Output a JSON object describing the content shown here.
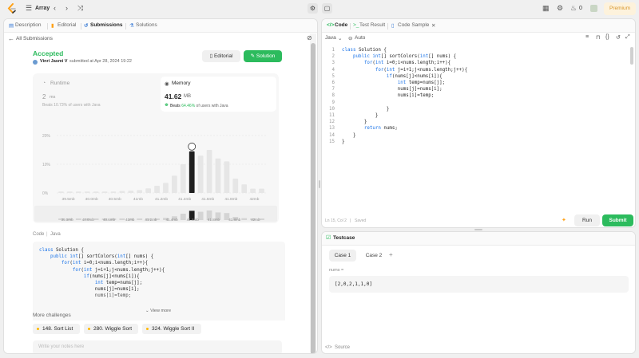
{
  "topbar": {
    "problem_list_label": "Array",
    "premium_label": "Premium",
    "streak_count": "0"
  },
  "left_tabs": [
    {
      "label": "Description"
    },
    {
      "label": "Editorial"
    },
    {
      "label": "Submissions"
    },
    {
      "label": "Solutions"
    }
  ],
  "submission": {
    "back_label": "All Submissions",
    "status": "Accepted",
    "author": "Vinri Jasmi V",
    "submitted_text": "submitted at Apr 28, 2024 19:22",
    "editorial_button": "Editorial",
    "solution_button": "Solution",
    "runtime": {
      "label": "Runtime",
      "value": "2",
      "unit": "ms",
      "beats": "Beats 10.73% of users with Java"
    },
    "memory": {
      "label": "Memory",
      "value": "41.62",
      "unit": "MB",
      "beats_prefix": "Beats",
      "beats_pct": "64.46%",
      "beats_suffix": "of users with Java"
    }
  },
  "chart_data": {
    "type": "bar",
    "ylabels": [
      "20%",
      "10%",
      "0%"
    ],
    "ylim": [
      0,
      20
    ],
    "categories": [
      "39.5mb",
      "40.0mb",
      "40.6mb",
      "41mb",
      "41.2mb",
      "41.4mb",
      "41.6mb",
      "41.8mb",
      "41.8mb",
      "42mb"
    ],
    "tick_labels": [
      "39.5mb",
      "40.0mb",
      "40.5mb",
      "41mb",
      "41.2mb",
      "41.4mb",
      "41.6mb",
      "41.8mb",
      "42mb"
    ],
    "values": [
      0.5,
      0.5,
      0.5,
      0.5,
      0.5,
      0.5,
      0.5,
      0.7,
      0.8,
      1.0,
      1.6,
      2.5,
      3.5,
      6,
      10,
      14.5,
      13,
      15,
      12,
      11,
      5,
      3,
      1.5,
      1.5
    ],
    "highlight_index": 15,
    "mini_labels": [
      "39.5mb",
      "40.0mb",
      "40.6mb",
      "41mb",
      "41.2mb",
      "41.4mb",
      "41.6mb",
      "41.8mb",
      "41.8mb",
      "42mb"
    ]
  },
  "code_section": {
    "label": "Code",
    "language": "Java",
    "lines": [
      "class Solution {",
      "    public int[] sortColors(int[] nums) {",
      "        for(int i=0;i<nums.length;i++){",
      "            for(int j=i+1;j<nums.length;j++){",
      "                if(nums[j]<nums[i]){",
      "                    int temp=nums[j];",
      "                    nums[j]=nums[i];",
      "                    nums[i]=temp;"
    ],
    "view_more": "View more"
  },
  "challenges": {
    "title": "More challenges",
    "items": [
      {
        "label": "148. Sort List"
      },
      {
        "label": "280. Wiggle Sort"
      },
      {
        "label": "324. Wiggle Sort II"
      }
    ]
  },
  "notes_placeholder": "Write your notes here",
  "editor": {
    "tabs": [
      {
        "label": "Code"
      },
      {
        "label": "Test Result"
      },
      {
        "label": "Code Sample"
      }
    ],
    "language": "Java",
    "mode": "Auto",
    "lines": [
      "class Solution {",
      "    public int[] sortColors(int[] nums) {",
      "        for(int i=0;i<nums.length;i++){",
      "            for(int j=i+1;j<nums.length;j++){",
      "                if(nums[j]<nums[i]){",
      "                    int temp=nums[j];",
      "                    nums[j]=nums[i];",
      "                    nums[i]=temp;",
      "",
      "                }",
      "            }",
      "        }",
      "        return nums;",
      "    }",
      "}"
    ],
    "status_text": "Ln 15, Col 2",
    "saved_text": "Saved",
    "run_label": "Run",
    "submit_label": "Submit"
  },
  "testcase": {
    "title": "Testcase",
    "cases": [
      {
        "label": "Case 1"
      },
      {
        "label": "Case 2"
      }
    ],
    "param_label": "nums =",
    "param_value": "[2,0,2,1,1,0]",
    "source_label": "Source"
  }
}
